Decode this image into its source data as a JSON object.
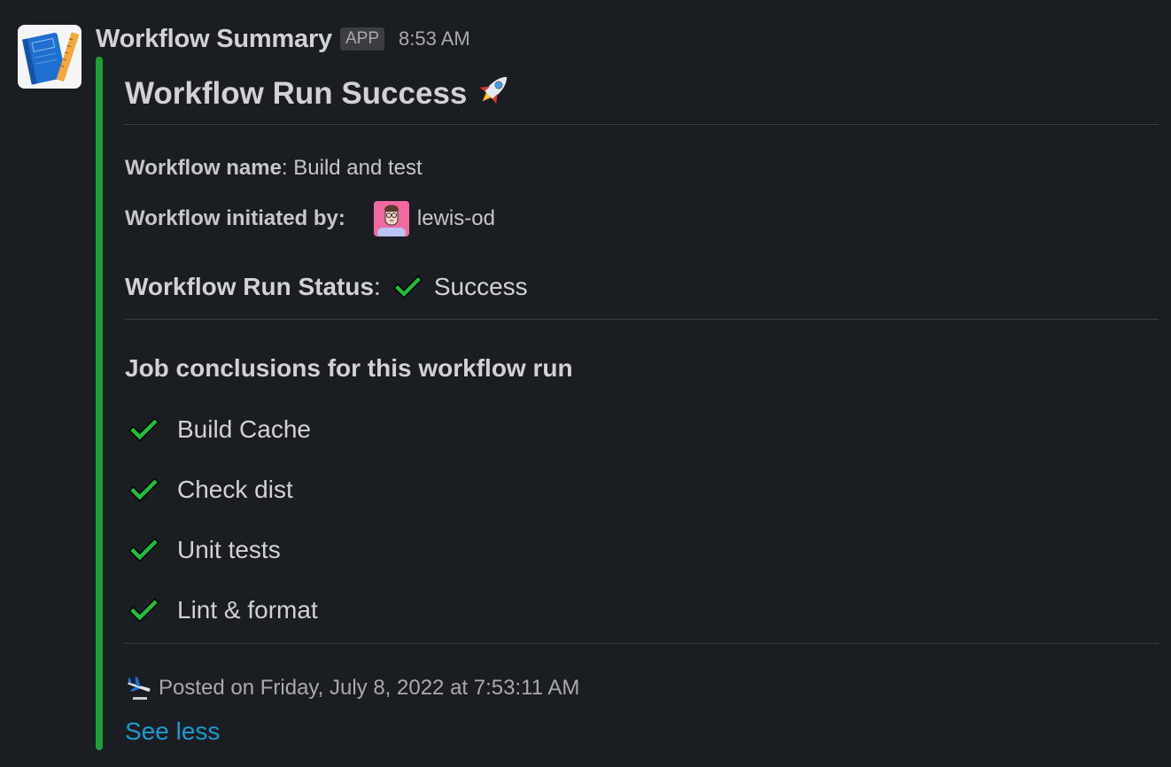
{
  "message": {
    "bot_name": "Workflow Summary",
    "app_badge": "APP",
    "timestamp": "8:53 AM",
    "accent_color": "#1da039"
  },
  "attachment": {
    "heading": "Workflow Run Success",
    "heading_emoji": "rocket-icon",
    "workflow_name_label": "Workflow name",
    "workflow_name_value": ": Build and test",
    "initiated_by_label": "Workflow initiated by:",
    "initiated_by_user": "lewis-od",
    "run_status_label": "Workflow Run Status",
    "run_status_value": "Success",
    "jobs_title": "Job conclusions for this workflow run",
    "jobs": [
      {
        "name": "Build Cache",
        "status_icon": "check-icon"
      },
      {
        "name": "Check dist",
        "status_icon": "check-icon"
      },
      {
        "name": "Unit tests",
        "status_icon": "check-icon"
      },
      {
        "name": "Lint & format",
        "status_icon": "check-icon"
      }
    ],
    "footer_text": "Posted on Friday, July 8, 2022 at 7:53:11 AM",
    "footer_icon": "airplane-departure-icon",
    "see_less": "See less"
  },
  "colors": {
    "background": "#1a1d21",
    "check_green": "#1fbf3a",
    "link": "#1d9bd1"
  }
}
